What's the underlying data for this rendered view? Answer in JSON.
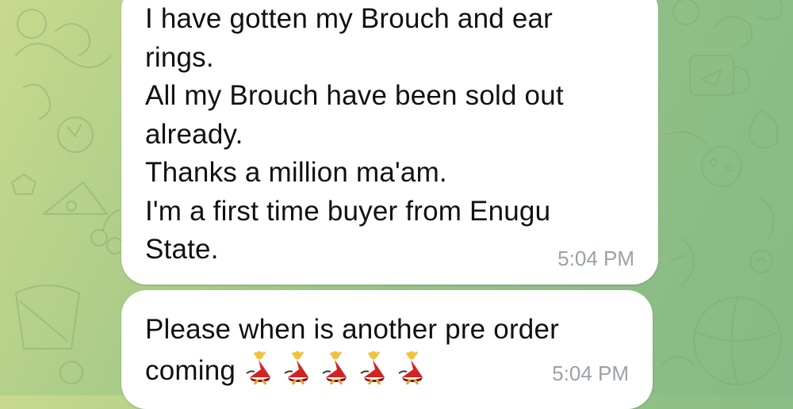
{
  "messages": [
    {
      "text": "I have gotten my Brouch and ear\nrings.\nAll my Brouch have been sold out\nalready.\nThanks a million ma'am.\nI'm a first time buyer from Enugu\nState.",
      "time": "5:04 PM"
    },
    {
      "text": "Please when is another pre order\ncoming",
      "emoji": [
        "woman-dancing-icon",
        "woman-dancing-icon",
        "woman-dancing-icon",
        "woman-dancing-icon",
        "woman-dancing-icon"
      ],
      "time": "5:04 PM"
    }
  ],
  "colors": {
    "bubble": "#ffffff",
    "time": "#9aa1a8",
    "wallpaper_start": "#c9d98e",
    "wallpaper_end": "#86b985"
  }
}
